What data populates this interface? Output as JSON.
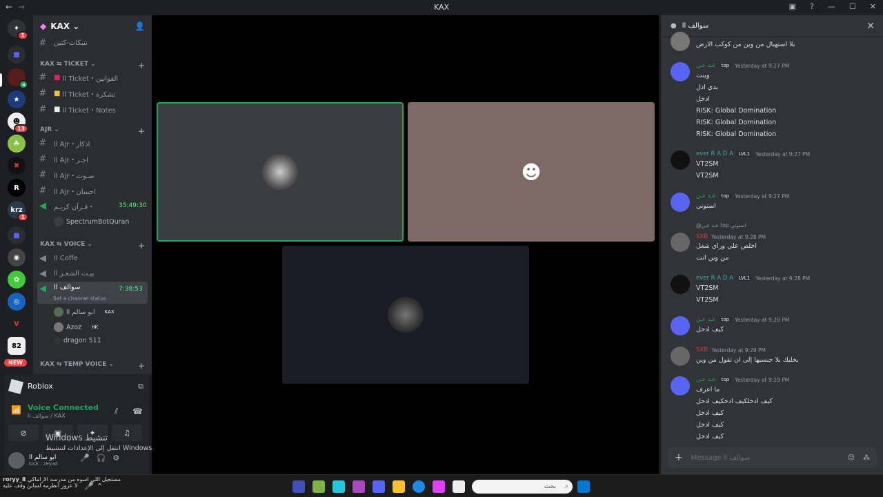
{
  "window": {
    "title": "KAX",
    "nav_back": "←",
    "nav_fwd": "→"
  },
  "server": {
    "name": "KAX",
    "chevron": "⌄"
  },
  "channels": {
    "top_channel": "تنبكات-كتين",
    "cat_ticket": "KAX ⇆ TICKET",
    "ticket_1": "اا Ticket・القوانين",
    "ticket_2": "اا Ticket・تشكرة",
    "ticket_3": "اا Ticket・Notes",
    "cat_ajr": "Ajr",
    "ajr_1": "اا Ajr・اذكار",
    "ajr_2": "اا Ajr・اجـر",
    "ajr_3": "اا Ajr・صـوت",
    "ajr_4": "اا Ajr・احسان",
    "quran": "قـرآن كريـم・",
    "quran_timer": "35:49:30",
    "quran_user": "SpectrumBotQuran",
    "cat_voice": "KAX ⇆ VOICE",
    "voice_1": "اا Coffe",
    "voice_2": "بيـت الشعـر اا",
    "voice_active": "سوالف اا",
    "voice_active_timer": "7:38:53",
    "voice_active_status": "Set a channel status",
    "vu_1": "ابو سالم اا",
    "vu_1_tag": "KAX",
    "vu_2": "Azoz",
    "vu_2_tag": "HK",
    "vu_3": "dragon 511",
    "cat_temp": "KAX ⇆ TEMP VOICE"
  },
  "activity": {
    "game": "Roblox"
  },
  "voice_panel": {
    "status": "Voice Connected",
    "channel": "سوالف اا / KAX"
  },
  "user_panel": {
    "name": "ابو سالم اا",
    "status": "kick : zeyad"
  },
  "watermark": {
    "line1": "Windows تنشيط",
    "line2": "انتقل إلى الإعدادات لتنشيط Windows"
  },
  "chat": {
    "title": "سوالف اا",
    "messages": [
      {
        "user": "",
        "time": "",
        "lines": [
          "بلا استهبال من وين من كوكب الارض"
        ]
      },
      {
        "user": "عـد عـن",
        "badge": "top",
        "time": "Yesterday at 9:27 PM",
        "lines": [
          "وينت",
          "بدي ادل",
          "ادخل",
          "RISK: Global Domination",
          "RISK: Global Domination",
          "RISK: Global Domination"
        ]
      },
      {
        "user": "ever R A D A",
        "badge": "LVL1",
        "time": "Yesterday at 9:27 PM",
        "lines": [
          "VT2SM",
          "VT2SM"
        ]
      },
      {
        "user": "عـد عـن",
        "badge": "top",
        "time": "Yesterday at 9:27 PM",
        "lines": [
          "استوني"
        ]
      },
      {
        "user": "SXB",
        "badge": "",
        "time": "Yesterday at 9:28 PM",
        "reply": "@عـد عـن top استوني",
        "lines": [
          "اخلص علي وراي شغل",
          "من وين انت"
        ]
      },
      {
        "user": "ever R A D A",
        "badge": "LVL1",
        "time": "Yesterday at 9:28 PM",
        "lines": [
          "VT2SM",
          "VT2SM"
        ]
      },
      {
        "user": "عـد عـن",
        "badge": "top",
        "time": "Yesterday at 9:29 PM",
        "lines": [
          "كيف ادخل"
        ]
      },
      {
        "user": "SXB",
        "badge": "",
        "time": "Yesterday at 9:29 PM",
        "lines": [
          "بخليك بلا جنسيها إلى ان تقول من وين"
        ]
      },
      {
        "user": "عـد عـن",
        "badge": "top",
        "time": "Yesterday at 9:29 PM",
        "lines": [
          "ما اعرف",
          "كيف ادخلكيف ادخكيف ادخل",
          "كيف ادخل",
          "كيف ادخل",
          "كيف ادخل"
        ]
      }
    ],
    "composer_placeholder": "Message سوالف اا"
  },
  "taskbar": {
    "search_placeholder": "بحث",
    "tray_user": "roryy_8",
    "tray_text": "مستجيل اللي اسوه من مدرسه الاراماكي",
    "tray_text2": "لا عزوز انطرمه لساين وقف عليه"
  },
  "colors": {
    "accent": "#5865f2",
    "online": "#23a55a",
    "timer": "#57f287"
  }
}
